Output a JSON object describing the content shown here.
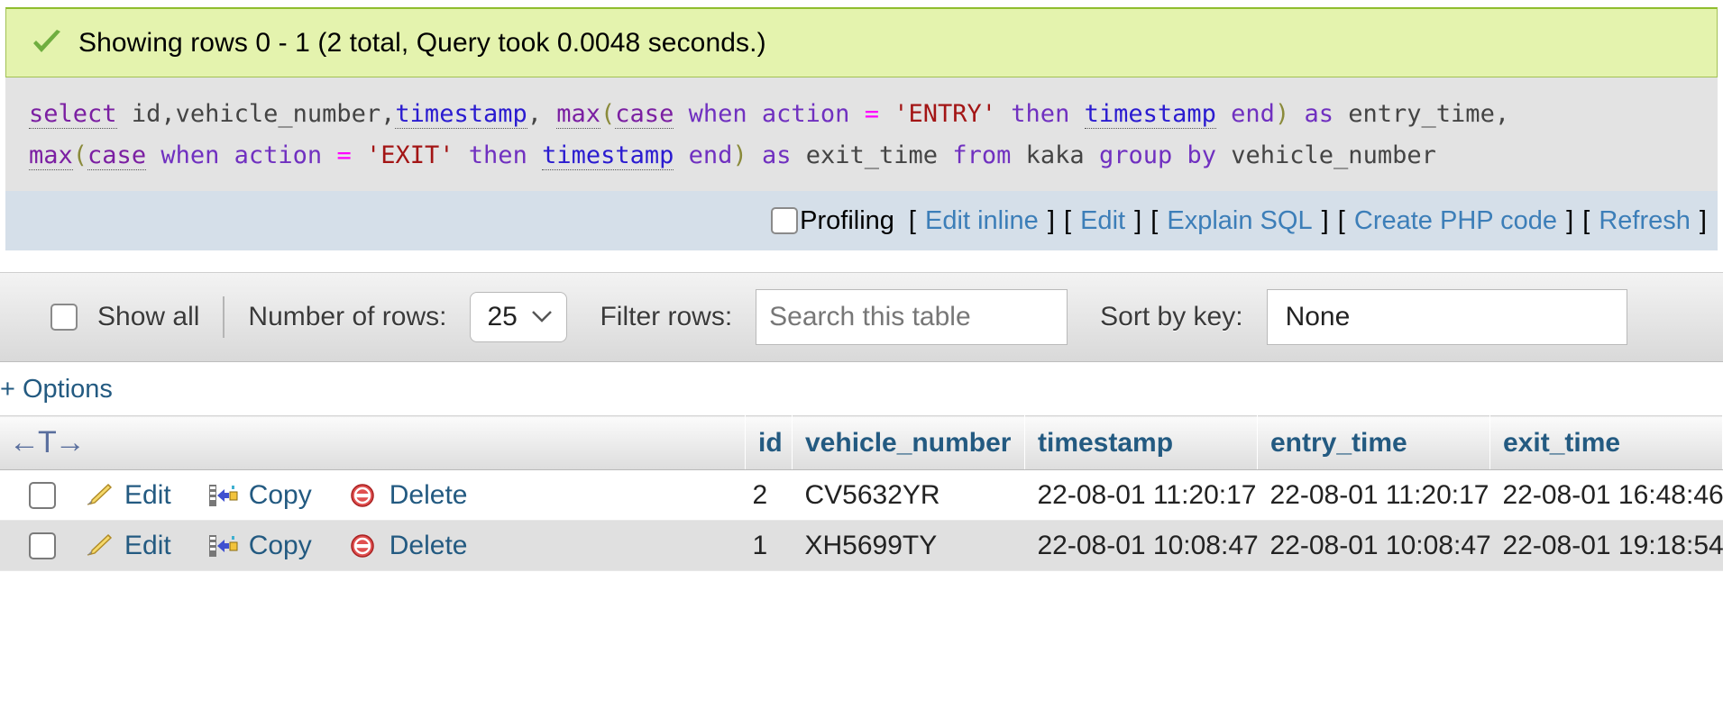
{
  "status": {
    "icon": "success-check-icon",
    "message": "Showing rows 0 - 1 (2 total, Query took 0.0048 seconds.)"
  },
  "sql": {
    "line1": [
      {
        "t": "select",
        "c": "kw"
      },
      {
        "t": " ",
        "c": "sp"
      },
      {
        "t": "id,vehicle_number,",
        "c": "ident"
      },
      {
        "t": "timestamp",
        "c": "tstamp"
      },
      {
        "t": ", ",
        "c": "ident"
      },
      {
        "t": "max",
        "c": "kw"
      },
      {
        "t": "(",
        "c": "paren"
      },
      {
        "t": "case",
        "c": "kw"
      },
      {
        "t": " ",
        "c": "sp"
      },
      {
        "t": "when",
        "c": "kw2"
      },
      {
        "t": " ",
        "c": "sp"
      },
      {
        "t": "action",
        "c": "kw2"
      },
      {
        "t": " ",
        "c": "sp"
      },
      {
        "t": "=",
        "c": "eq"
      },
      {
        "t": " ",
        "c": "sp"
      },
      {
        "t": "'ENTRY'",
        "c": "str"
      },
      {
        "t": " ",
        "c": "sp"
      },
      {
        "t": "then",
        "c": "kw2"
      },
      {
        "t": " ",
        "c": "sp"
      },
      {
        "t": "timestamp",
        "c": "tstamp"
      },
      {
        "t": " ",
        "c": "sp"
      },
      {
        "t": "end",
        "c": "kw2"
      },
      {
        "t": ")",
        "c": "paren"
      },
      {
        "t": " ",
        "c": "sp"
      },
      {
        "t": "as",
        "c": "kw2"
      },
      {
        "t": " ",
        "c": "sp"
      },
      {
        "t": "entry_time,",
        "c": "ident"
      }
    ],
    "line2": [
      {
        "t": "max",
        "c": "kw"
      },
      {
        "t": "(",
        "c": "paren"
      },
      {
        "t": "case",
        "c": "kw"
      },
      {
        "t": " ",
        "c": "sp"
      },
      {
        "t": "when",
        "c": "kw2"
      },
      {
        "t": " ",
        "c": "sp"
      },
      {
        "t": "action",
        "c": "kw2"
      },
      {
        "t": " ",
        "c": "sp"
      },
      {
        "t": "=",
        "c": "eq"
      },
      {
        "t": " ",
        "c": "sp"
      },
      {
        "t": "'EXIT'",
        "c": "str"
      },
      {
        "t": " ",
        "c": "sp"
      },
      {
        "t": "then",
        "c": "kw2"
      },
      {
        "t": " ",
        "c": "sp"
      },
      {
        "t": "timestamp",
        "c": "tstamp"
      },
      {
        "t": " ",
        "c": "sp"
      },
      {
        "t": "end",
        "c": "kw2"
      },
      {
        "t": ")",
        "c": "paren"
      },
      {
        "t": " ",
        "c": "sp"
      },
      {
        "t": "as",
        "c": "kw2"
      },
      {
        "t": " ",
        "c": "sp"
      },
      {
        "t": "exit_time",
        "c": "ident"
      },
      {
        "t": " ",
        "c": "sp"
      },
      {
        "t": "from",
        "c": "kw2"
      },
      {
        "t": " ",
        "c": "sp"
      },
      {
        "t": "kaka",
        "c": "ident"
      },
      {
        "t": " ",
        "c": "sp"
      },
      {
        "t": "group",
        "c": "kw2"
      },
      {
        "t": " ",
        "c": "sp"
      },
      {
        "t": "by",
        "c": "kw2"
      },
      {
        "t": " ",
        "c": "sp"
      },
      {
        "t": "vehicle_number",
        "c": "ident"
      }
    ]
  },
  "profiling": {
    "label": "Profiling",
    "checked": false,
    "links": [
      "Edit inline",
      "Edit",
      "Explain SQL",
      "Create PHP code",
      "Refresh"
    ],
    "open_bracket": "[",
    "close_bracket": "]"
  },
  "options_bar": {
    "show_all_label": "Show all",
    "show_all_checked": false,
    "number_of_rows_label": "Number of rows:",
    "number_of_rows_value": "25",
    "filter_rows_label": "Filter rows:",
    "filter_placeholder": "Search this table",
    "filter_value": "",
    "sort_by_key_label": "Sort by key:",
    "sort_by_key_value": "None",
    "chevron": "⌄"
  },
  "options_link": "+ Options",
  "table": {
    "nav_arrows": "←T→",
    "headers": [
      "id",
      "vehicle_number",
      "timestamp",
      "entry_time",
      "exit_time"
    ],
    "actions": {
      "edit": "Edit",
      "copy": "Copy",
      "delete": "Delete"
    },
    "rows": [
      {
        "id": "2",
        "vehicle_number": "CV5632YR",
        "timestamp": "22-08-01 11:20:17",
        "entry_time": "22-08-01 11:20:17",
        "exit_time": "22-08-01 16:48:46"
      },
      {
        "id": "1",
        "vehicle_number": "XH5699TY",
        "timestamp": "22-08-01 10:08:47",
        "entry_time": "22-08-01 10:08:47",
        "exit_time": "22-08-01 19:18:54"
      }
    ]
  },
  "colors": {
    "success_bg": "#e4f3ae",
    "success_border": "#8fbe2e",
    "sql_bg": "#e3e3e3",
    "profiling_bg": "#d5dfe9",
    "link": "#3c7eb8",
    "header_text": "#235a81",
    "keyword": "#7b1fa2",
    "string": "#a31515",
    "operator": "#ff00ff"
  }
}
